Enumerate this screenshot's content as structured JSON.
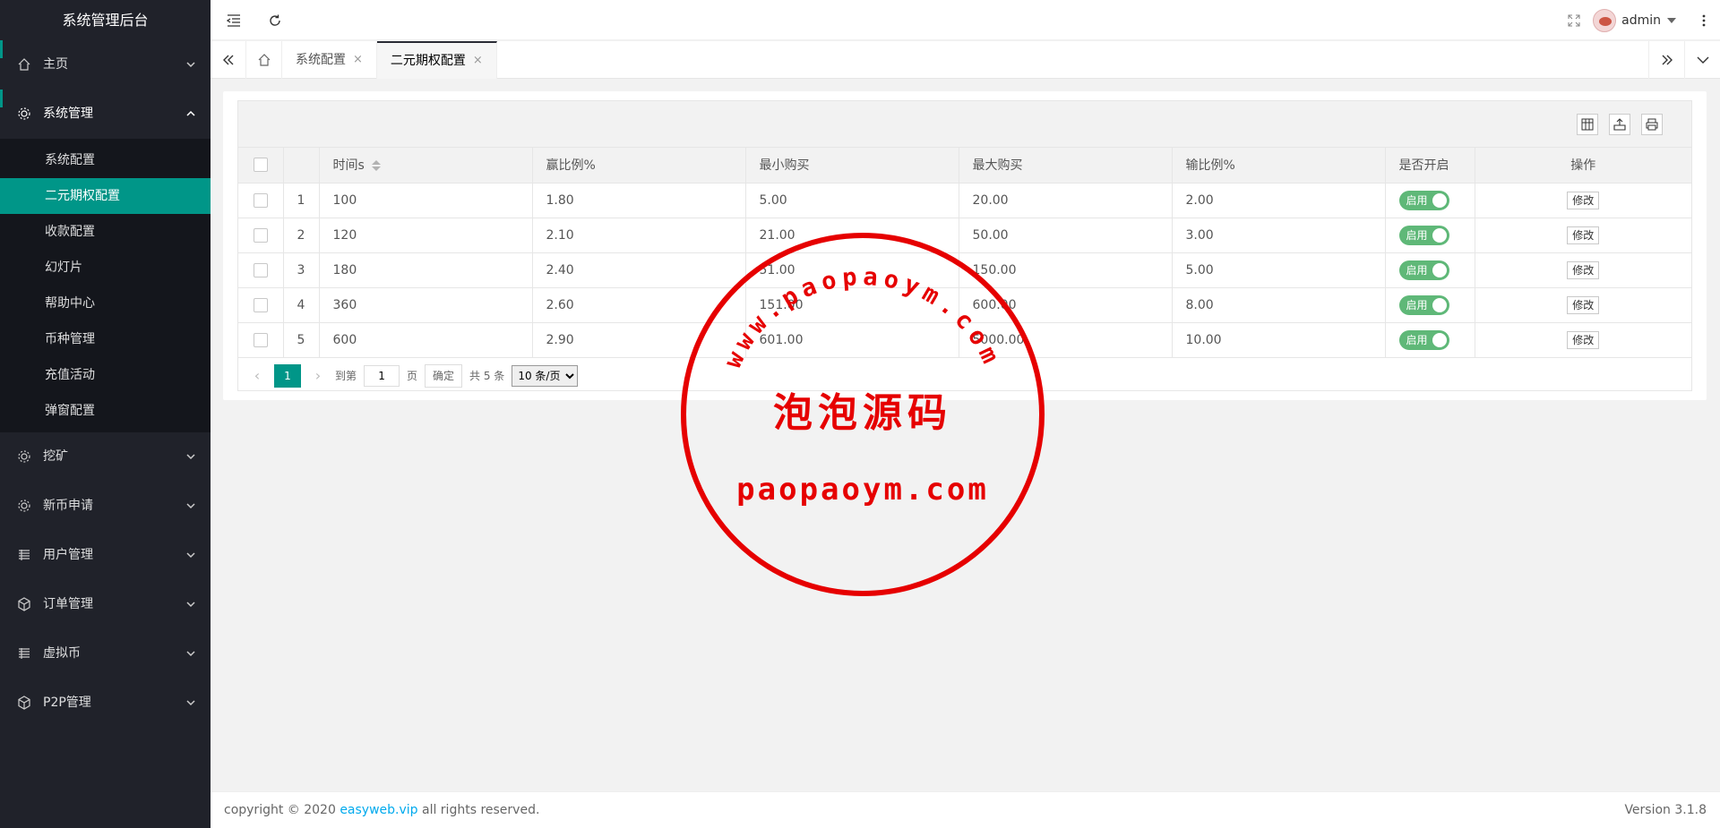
{
  "app": {
    "title": "系统管理后台"
  },
  "sidebar": {
    "groups": [
      {
        "label": "主页",
        "icon": "home-icon",
        "expanded": false
      },
      {
        "label": "系统管理",
        "icon": "gear-icon",
        "expanded": true,
        "items": [
          {
            "label": "系统配置",
            "active": false
          },
          {
            "label": "二元期权配置",
            "active": true
          },
          {
            "label": "收款配置",
            "active": false
          },
          {
            "label": "幻灯片",
            "active": false
          },
          {
            "label": "帮助中心",
            "active": false
          },
          {
            "label": "币种管理",
            "active": false
          },
          {
            "label": "充值活动",
            "active": false
          },
          {
            "label": "弹窗配置",
            "active": false
          }
        ]
      },
      {
        "label": "挖矿",
        "icon": "cog-icon",
        "expanded": false
      },
      {
        "label": "新币申请",
        "icon": "cog-icon",
        "expanded": false
      },
      {
        "label": "用户管理",
        "icon": "list-icon",
        "expanded": false
      },
      {
        "label": "订单管理",
        "icon": "cube-icon",
        "expanded": false
      },
      {
        "label": "虚拟币",
        "icon": "list-icon",
        "expanded": false
      },
      {
        "label": "P2P管理",
        "icon": "cube-icon",
        "expanded": false
      }
    ]
  },
  "header": {
    "user": "admin"
  },
  "tabs": [
    {
      "label": "系统配置",
      "active": false
    },
    {
      "label": "二元期权配置",
      "active": true
    }
  ],
  "table": {
    "columns": [
      "时间s",
      "赢比例%",
      "最小购买",
      "最大购买",
      "输比例%",
      "是否开启",
      "操作"
    ],
    "rows": [
      {
        "no": "1",
        "time": "100",
        "win": "1.80",
        "min": "5.00",
        "max": "20.00",
        "lose": "2.00",
        "switch": "启用",
        "action": "修改"
      },
      {
        "no": "2",
        "time": "120",
        "win": "2.10",
        "min": "21.00",
        "max": "50.00",
        "lose": "3.00",
        "switch": "启用",
        "action": "修改"
      },
      {
        "no": "3",
        "time": "180",
        "win": "2.40",
        "min": "51.00",
        "max": "150.00",
        "lose": "5.00",
        "switch": "启用",
        "action": "修改"
      },
      {
        "no": "4",
        "time": "360",
        "win": "2.60",
        "min": "151.00",
        "max": "600.00",
        "lose": "8.00",
        "switch": "启用",
        "action": "修改"
      },
      {
        "no": "5",
        "time": "600",
        "win": "2.90",
        "min": "601.00",
        "max": "5000.00",
        "lose": "10.00",
        "switch": "启用",
        "action": "修改"
      }
    ]
  },
  "pager": {
    "current": "1",
    "goto_label": "到第",
    "page_input": "1",
    "page_suffix": "页",
    "confirm": "确定",
    "total": "共 5 条",
    "page_size": "10 条/页"
  },
  "footer": {
    "prefix": "copyright © 2020 ",
    "link": "easyweb.vip",
    "suffix": " all rights reserved.",
    "version": "Version 3.1.8"
  },
  "watermark": {
    "arc_text": "www.paopaoym.com",
    "title": "泡泡源码",
    "domain": "paopaoym.com",
    "color": "#e60000"
  }
}
